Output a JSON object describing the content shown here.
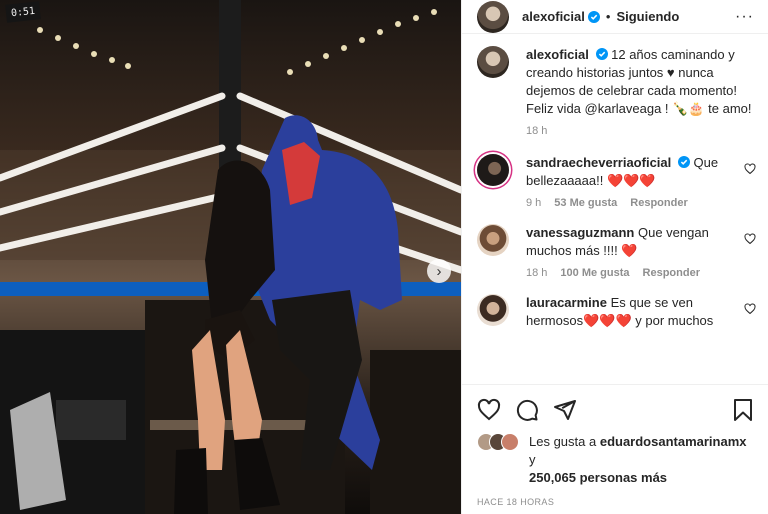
{
  "post": {
    "photo_alt_icon": "image",
    "clock_text": "0:51",
    "carousel_next_icon": "chevron-right-icon"
  },
  "header": {
    "username": "alexoficial",
    "separator": "•",
    "follow_label": "Siguiendo",
    "more_icon": "ellipsis-icon",
    "more_label": "···"
  },
  "caption": {
    "username": "alexoficial",
    "text": "12 años caminando y creando historias juntos ♥ nunca dejemos de celebrar cada momento! Feliz vida @karlaveaga ! 🍾🎂 te amo!",
    "time": "18 h"
  },
  "comments": [
    {
      "username": "sandraecheverriaoficial",
      "verified": true,
      "text": "Que bellezaaaaa!! ❤️❤️❤️",
      "time": "9 h",
      "likes": "53 Me gusta",
      "reply": "Responder"
    },
    {
      "username": "vanessaguzmann",
      "verified": false,
      "text": "Que vengan muchos más !!!! ❤️",
      "time": "18 h",
      "likes": "100 Me gusta",
      "reply": "Responder"
    },
    {
      "username": "lauracarmine",
      "verified": false,
      "text": "Es que se ven hermosos❤️❤️❤️ y por muchos",
      "time": "",
      "likes": "",
      "reply": ""
    }
  ],
  "likes": {
    "prefix": "Les gusta a",
    "user": "eduardosantamarinamx",
    "connector": "y",
    "count": "250,065 personas más"
  },
  "timestamp": "HACE 18 HORAS",
  "colors": {
    "accent": "#0095f6",
    "heart": "#ed2939",
    "muted": "#8e8e8e",
    "text": "#262626"
  }
}
